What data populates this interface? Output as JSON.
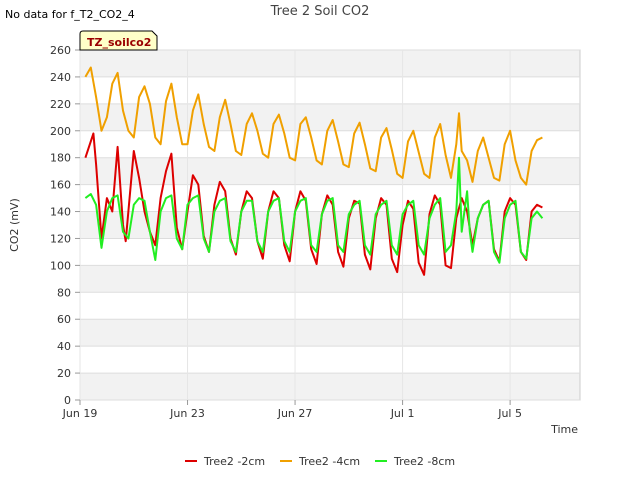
{
  "no_data_note": "No data for f_T2_CO2_4",
  "badge_label": "TZ_soilco2",
  "chart_data": {
    "type": "line",
    "title": "Tree 2 Soil CO2",
    "xlabel": "Time",
    "ylabel": "CO2 (mV)",
    "ylim": [
      0,
      260
    ],
    "y_ticks": [
      0,
      20,
      40,
      60,
      80,
      100,
      120,
      140,
      160,
      180,
      200,
      220,
      240,
      260
    ],
    "x_range": [
      "2023-06-19",
      "2023-07-07"
    ],
    "x_ticks": [
      {
        "label": "Jun 19",
        "day": 0
      },
      {
        "label": "Jun 23",
        "day": 4
      },
      {
        "label": "Jun 27",
        "day": 8
      },
      {
        "label": "Jul 1",
        "day": 12
      },
      {
        "label": "Jul 5",
        "day": 16
      }
    ],
    "grid": true,
    "legend_position": "bottom",
    "series": [
      {
        "name": "Tree2 -2cm",
        "color": "#dd0000",
        "x": [
          0.2,
          0.5,
          0.6,
          0.8,
          1.0,
          1.2,
          1.4,
          1.6,
          1.7,
          2.0,
          2.2,
          2.4,
          2.6,
          2.8,
          3.0,
          3.2,
          3.4,
          3.6,
          3.8,
          4.0,
          4.2,
          4.4,
          4.6,
          4.8,
          5.0,
          5.2,
          5.4,
          5.6,
          5.8,
          6.0,
          6.2,
          6.4,
          6.6,
          6.8,
          7.0,
          7.2,
          7.4,
          7.6,
          7.8,
          8.0,
          8.2,
          8.4,
          8.6,
          8.8,
          9.0,
          9.2,
          9.4,
          9.6,
          9.8,
          10.0,
          10.2,
          10.4,
          10.6,
          10.8,
          11.0,
          11.2,
          11.4,
          11.6,
          11.8,
          12.0,
          12.2,
          12.4,
          12.6,
          12.8,
          13.0,
          13.2,
          13.4,
          13.6,
          13.8,
          14.0,
          14.2,
          14.4,
          14.6,
          14.8,
          15.0,
          15.2,
          15.4,
          15.6,
          15.8,
          16.0,
          16.2,
          16.4,
          16.6,
          16.8,
          17.0,
          17.2
        ],
        "y": [
          180,
          198,
          175,
          120,
          150,
          140,
          188,
          130,
          118,
          185,
          165,
          140,
          125,
          115,
          150,
          170,
          183,
          128,
          112,
          140,
          167,
          160,
          122,
          110,
          145,
          162,
          155,
          120,
          108,
          140,
          155,
          150,
          118,
          105,
          140,
          155,
          150,
          115,
          103,
          140,
          155,
          148,
          112,
          101,
          138,
          152,
          145,
          110,
          99,
          135,
          148,
          146,
          108,
          97,
          135,
          150,
          145,
          105,
          95,
          130,
          148,
          142,
          102,
          93,
          138,
          152,
          145,
          100,
          98,
          135,
          150,
          140,
          115,
          135,
          145,
          148,
          112,
          103,
          140,
          150,
          145,
          110,
          104,
          140,
          145,
          143
        ]
      },
      {
        "name": "Tree2 -4cm",
        "color": "#f0a000",
        "x": [
          0.2,
          0.4,
          0.6,
          0.8,
          1.0,
          1.2,
          1.4,
          1.6,
          1.8,
          2.0,
          2.2,
          2.4,
          2.6,
          2.8,
          3.0,
          3.2,
          3.4,
          3.6,
          3.8,
          4.0,
          4.2,
          4.4,
          4.6,
          4.8,
          5.0,
          5.2,
          5.4,
          5.6,
          5.8,
          6.0,
          6.2,
          6.4,
          6.6,
          6.8,
          7.0,
          7.2,
          7.4,
          7.6,
          7.8,
          8.0,
          8.2,
          8.4,
          8.6,
          8.8,
          9.0,
          9.2,
          9.4,
          9.6,
          9.8,
          10.0,
          10.2,
          10.4,
          10.6,
          10.8,
          11.0,
          11.2,
          11.4,
          11.6,
          11.8,
          12.0,
          12.2,
          12.4,
          12.6,
          12.8,
          13.0,
          13.2,
          13.4,
          13.6,
          13.8,
          14.0,
          14.1,
          14.2,
          14.4,
          14.6,
          14.8,
          15.0,
          15.2,
          15.4,
          15.6,
          15.8,
          16.0,
          16.2,
          16.4,
          16.6,
          16.8,
          17.0,
          17.2
        ],
        "y": [
          240,
          247,
          225,
          200,
          210,
          235,
          243,
          215,
          200,
          195,
          225,
          233,
          220,
          195,
          190,
          222,
          235,
          210,
          190,
          190,
          215,
          227,
          205,
          188,
          185,
          210,
          223,
          205,
          185,
          182,
          205,
          213,
          200,
          183,
          180,
          205,
          212,
          198,
          180,
          178,
          205,
          210,
          195,
          178,
          175,
          200,
          208,
          192,
          175,
          173,
          198,
          206,
          190,
          172,
          170,
          195,
          202,
          186,
          168,
          165,
          192,
          200,
          184,
          168,
          165,
          195,
          205,
          182,
          165,
          190,
          213,
          185,
          178,
          162,
          185,
          195,
          180,
          165,
          163,
          190,
          200,
          178,
          165,
          160,
          185,
          193,
          195
        ]
      },
      {
        "name": "Tree2 -8cm",
        "color": "#22ee22",
        "x": [
          0.2,
          0.4,
          0.6,
          0.8,
          1.0,
          1.2,
          1.4,
          1.6,
          1.8,
          2.0,
          2.2,
          2.4,
          2.6,
          2.8,
          3.0,
          3.2,
          3.4,
          3.6,
          3.8,
          4.0,
          4.2,
          4.4,
          4.6,
          4.8,
          5.0,
          5.2,
          5.4,
          5.6,
          5.8,
          6.0,
          6.2,
          6.4,
          6.6,
          6.8,
          7.0,
          7.2,
          7.4,
          7.6,
          7.8,
          8.0,
          8.2,
          8.4,
          8.6,
          8.8,
          9.0,
          9.2,
          9.4,
          9.6,
          9.8,
          10.0,
          10.2,
          10.4,
          10.6,
          10.8,
          11.0,
          11.2,
          11.4,
          11.6,
          11.8,
          12.0,
          12.2,
          12.4,
          12.6,
          12.8,
          13.0,
          13.2,
          13.4,
          13.6,
          13.8,
          14.0,
          14.1,
          14.2,
          14.4,
          14.5,
          14.6,
          14.8,
          15.0,
          15.2,
          15.4,
          15.6,
          15.8,
          16.0,
          16.2,
          16.4,
          16.6,
          16.8,
          17.0,
          17.2
        ],
        "y": [
          150,
          153,
          145,
          113,
          140,
          150,
          152,
          125,
          120,
          145,
          150,
          148,
          125,
          104,
          140,
          150,
          152,
          120,
          112,
          145,
          150,
          152,
          120,
          110,
          140,
          148,
          150,
          118,
          110,
          140,
          148,
          148,
          118,
          110,
          140,
          148,
          150,
          118,
          110,
          140,
          148,
          150,
          115,
          110,
          138,
          148,
          150,
          115,
          110,
          138,
          145,
          148,
          115,
          108,
          138,
          145,
          148,
          115,
          108,
          138,
          145,
          148,
          115,
          108,
          135,
          145,
          150,
          110,
          115,
          140,
          180,
          125,
          155,
          125,
          110,
          135,
          145,
          148,
          110,
          102,
          135,
          145,
          148,
          110,
          105,
          135,
          140,
          135
        ]
      }
    ]
  }
}
